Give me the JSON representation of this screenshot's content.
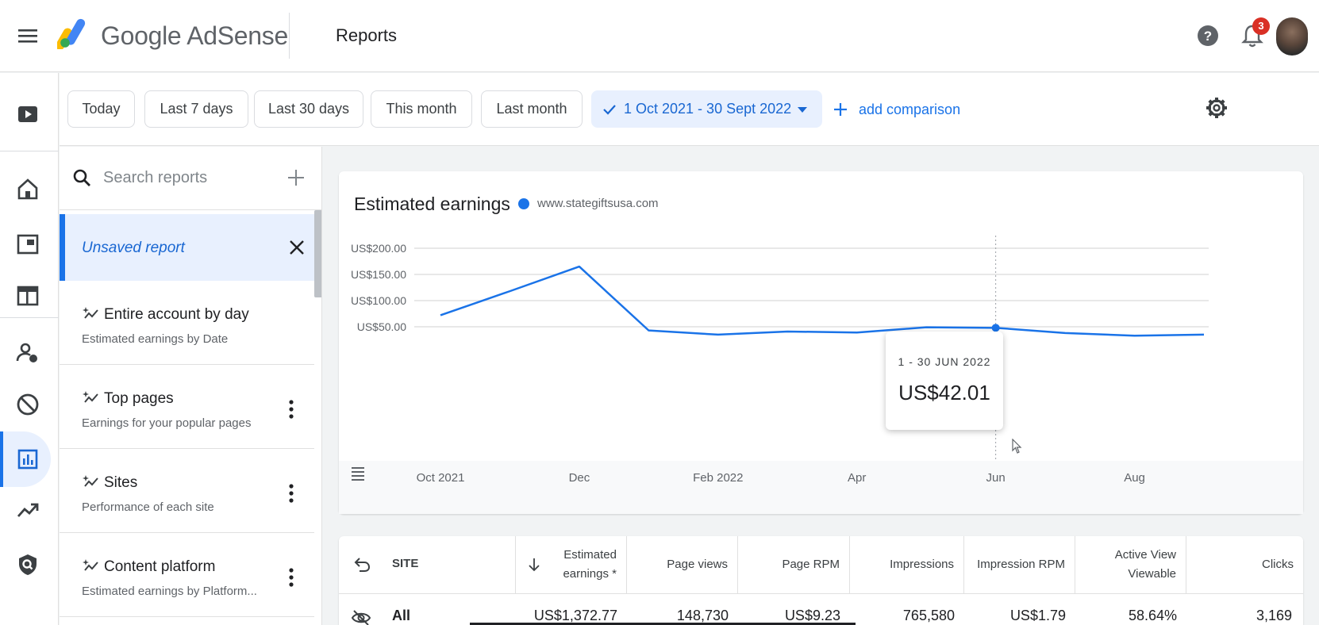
{
  "app": {
    "brand": "Google AdSense",
    "page_title": "Reports",
    "notification_count": "3"
  },
  "date_filters": {
    "chips": [
      "Today",
      "Last 7 days",
      "Last 30 days",
      "This month",
      "Last month"
    ],
    "selected_range": "1 Oct 2021 - 30 Sept 2022",
    "add_comparison": "add comparison"
  },
  "report_list": {
    "search_placeholder": "Search reports",
    "unsaved": "Unsaved report",
    "items": [
      {
        "title": "Entire account by day",
        "subtitle": "Estimated earnings by Date"
      },
      {
        "title": "Top pages",
        "subtitle": "Earnings for your popular pages"
      },
      {
        "title": "Sites",
        "subtitle": "Performance of each site"
      },
      {
        "title": "Content platform",
        "subtitle": "Estimated earnings by Platform..."
      }
    ]
  },
  "chart": {
    "title": "Estimated earnings",
    "tooltip": {
      "date": "1 - 30 JUN 2022",
      "value": "US$42.01"
    }
  },
  "chart_data": {
    "type": "line",
    "title": "Estimated earnings",
    "series": [
      {
        "name": "www.stategiftsusa.com",
        "color": "#1a73e8",
        "values": [
          72,
          118,
          165,
          43,
          35,
          41,
          39,
          49,
          48,
          38,
          33,
          35
        ]
      }
    ],
    "x": [
      "Oct 2021",
      "Nov 2021",
      "Dec 2021",
      "Jan 2022",
      "Feb 2022",
      "Mar 2022",
      "Apr 2022",
      "May 2022",
      "Jun 2022",
      "Jul 2022",
      "Aug 2022",
      "Sep 2022"
    ],
    "x_tick_labels": [
      "Oct 2021",
      "Dec",
      "Feb 2022",
      "Apr",
      "Jun",
      "Aug"
    ],
    "x_tick_indices": [
      0,
      2,
      4,
      6,
      8,
      10
    ],
    "y_ticks": [
      50,
      100,
      150,
      200
    ],
    "y_tick_labels": [
      "US$50.00",
      "US$100.00",
      "US$150.00",
      "US$200.00"
    ],
    "ylim": [
      0,
      200
    ],
    "highlight_index": 8,
    "grid": true,
    "legend": "top-left"
  },
  "table": {
    "headers": {
      "site": "SITE",
      "earnings": [
        "Estimated",
        "earnings *"
      ],
      "page_views": "Page views",
      "page_rpm": "Page RPM",
      "impressions": "Impressions",
      "impression_rpm": "Impression RPM",
      "active_view": [
        "Active View",
        "Viewable"
      ],
      "clicks": "Clicks"
    },
    "total_row": {
      "label": "All",
      "earnings": "US$1,372.77",
      "page_views": "148,730",
      "page_rpm": "US$9.23",
      "impressions": "765,580",
      "impression_rpm": "US$1.79",
      "active_view": "58.64%",
      "clicks": "3,169"
    }
  }
}
